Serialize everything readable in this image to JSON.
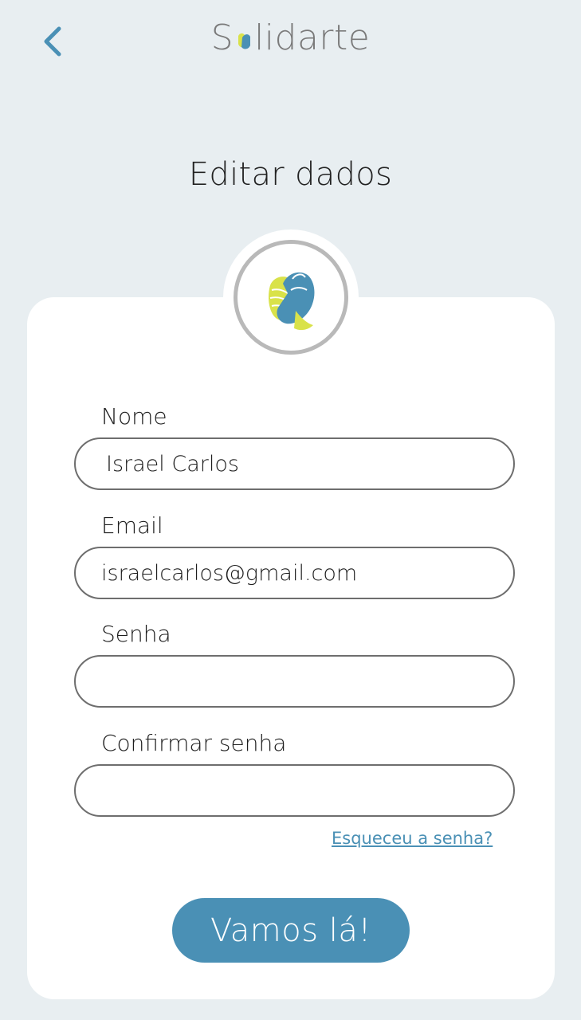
{
  "header": {
    "back_icon": "chevron-left-icon",
    "brand_prefix": "S",
    "brand_suffix": "lidarte",
    "brand_logo": "handshake-logo"
  },
  "page": {
    "title": "Editar dados"
  },
  "avatar": {
    "icon": "handshake-logo"
  },
  "form": {
    "name_label": "Nome",
    "name_value": "Israel Carlos",
    "email_label": "Email",
    "email_value": "israelcarlos@gmail.com",
    "password_label": "Senha",
    "password_value": "",
    "confirm_label": "Confirmar senha",
    "confirm_value": "",
    "forgot_link": "Esqueceu a senha?",
    "submit_label": "Vamos lá!"
  },
  "colors": {
    "background": "#e8eef1",
    "card": "#ffffff",
    "accent_blue": "#4a90b5",
    "accent_yellow": "#d9e24a",
    "brand_grey": "#7a7a7a"
  }
}
